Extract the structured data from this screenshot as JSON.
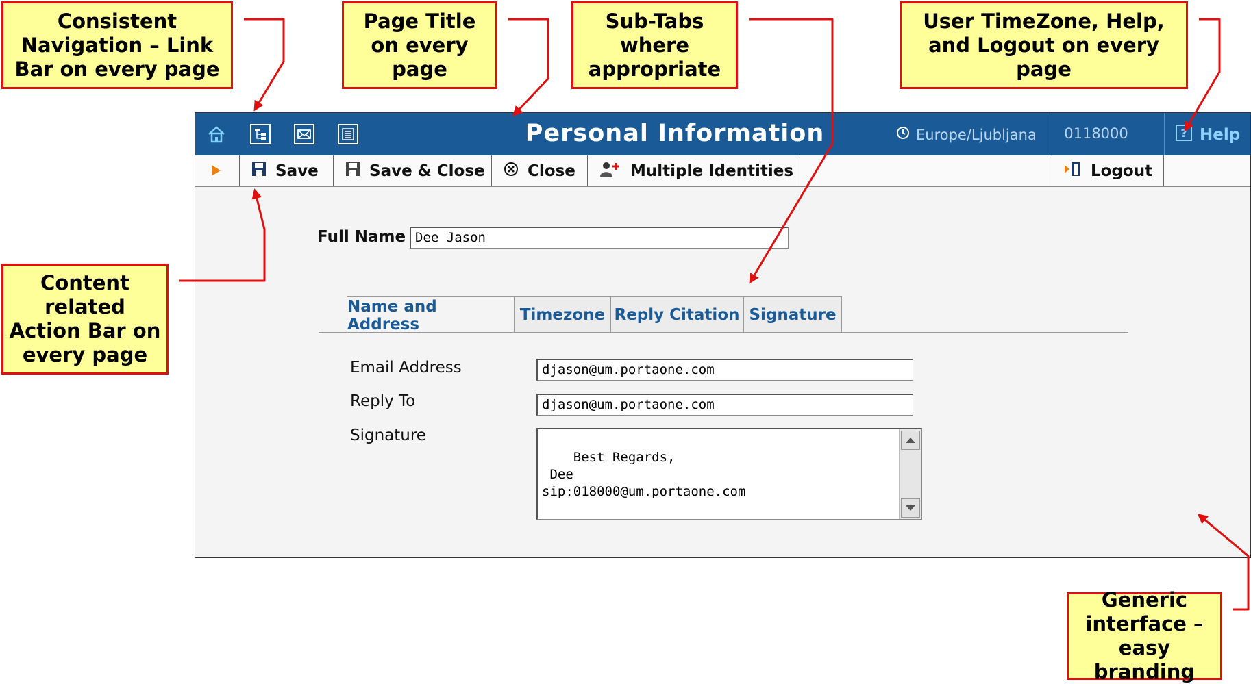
{
  "callouts": {
    "navigation": "Consistent\nNavigation – Link\nBar on every page",
    "page_title": "Page Title\non every\npage",
    "subtabs": "Sub-Tabs\nwhere\nappropriate",
    "user_tools": "User TimeZone, Help,\nand Logout on every\npage",
    "action_bar": "Content\nrelated\nAction Bar on\nevery page",
    "branding": "Generic\ninterface –\neasy branding"
  },
  "header": {
    "title": "Personal Information",
    "timezone": "Europe/Ljubljana",
    "account": "0118000",
    "help": "Help",
    "nav_icons": [
      "home-icon",
      "directory-icon",
      "mail-icon",
      "list-icon"
    ]
  },
  "toolbar": {
    "save": "Save",
    "save_close": "Save & Close",
    "close": "Close",
    "identities": "Multiple Identities",
    "logout": "Logout"
  },
  "form": {
    "full_name_label": "Full Name",
    "full_name_value": "Dee Jason",
    "tabs": [
      "Name and Address",
      "Timezone",
      "Reply Citation",
      "Signature"
    ],
    "email_label": "Email Address",
    "email_value": "djason@um.portaone.com",
    "reply_label": "Reply To",
    "reply_value": "djason@um.portaone.com",
    "signature_label": "Signature",
    "signature_value": "Best Regards,\n Dee\nsip:018000@um.portaone.com"
  },
  "colors": {
    "header_bg": "#1a5a96",
    "callout_bg": "#ffff99",
    "callout_border": "#e01010"
  }
}
